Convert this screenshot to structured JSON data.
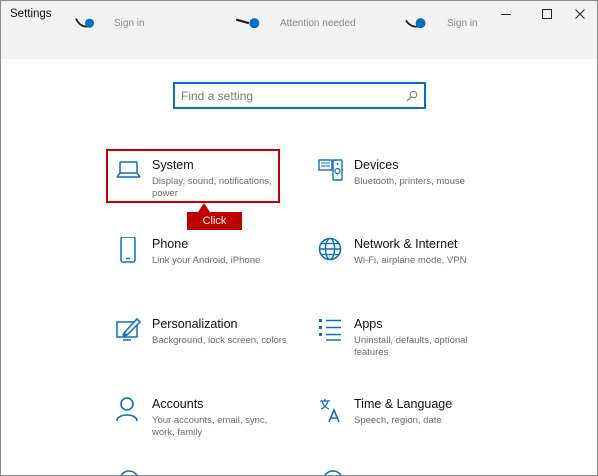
{
  "window": {
    "title": "Settings",
    "controls": {
      "minimize": "minimize",
      "maximize": "maximize",
      "close": "close"
    }
  },
  "header": {
    "accounts": [
      {
        "label": "Sign in"
      },
      {
        "label": "Attention needed"
      },
      {
        "label": "Sign in"
      }
    ]
  },
  "search": {
    "placeholder": "Find a setting",
    "value": ""
  },
  "tiles": [
    {
      "name": "System",
      "desc": "Display, sound, notifications, power",
      "icon": "laptop-icon"
    },
    {
      "name": "Devices",
      "desc": "Bluetooth, printers, mouse",
      "icon": "devices-icon"
    },
    {
      "name": "Phone",
      "desc": "Link your Android, iPhone",
      "icon": "phone-icon"
    },
    {
      "name": "Network & Internet",
      "desc": "Wi-Fi, airplane mode, VPN",
      "icon": "globe-icon"
    },
    {
      "name": "Personalization",
      "desc": "Background, lock screen, colors",
      "icon": "personalization-icon"
    },
    {
      "name": "Apps",
      "desc": "Uninstall, defaults, optional features",
      "icon": "apps-list-icon"
    },
    {
      "name": "Accounts",
      "desc": "Your accounts, email, sync, work, family",
      "icon": "person-icon"
    },
    {
      "name": "Time & Language",
      "desc": "Speech, region, date",
      "icon": "time-language-icon"
    }
  ],
  "annotation": {
    "callout": "Click"
  },
  "colors": {
    "accent": "#0a6fc2",
    "highlight": "#c00000",
    "titlebar": "#f2f2f2"
  }
}
